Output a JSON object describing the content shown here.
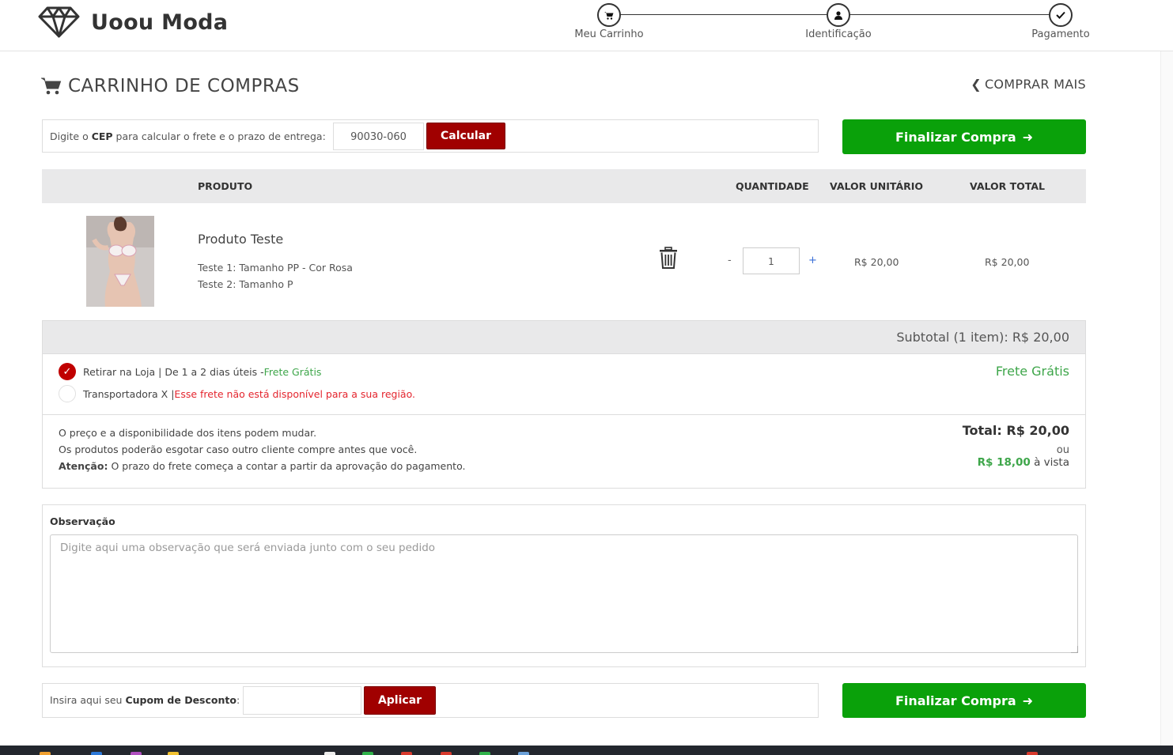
{
  "brand": {
    "name": "Uoou Moda",
    "logo_icon": "diamond-icon"
  },
  "steps": [
    {
      "label": "Meu Carrinho",
      "icon": "cart-icon"
    },
    {
      "label": "Identificação",
      "icon": "user-icon"
    },
    {
      "label": "Pagamento",
      "icon": "check-icon"
    }
  ],
  "page": {
    "title": "CARRINHO DE COMPRAS",
    "shop_more": "COMPRAR MAIS"
  },
  "cep": {
    "label_pre": "Digite o ",
    "label_bold": "CEP",
    "label_post": " para calcular o frete e o prazo de entrega:",
    "value": "90030-060",
    "button": "Calcular"
  },
  "checkout_button": "Finalizar Compra",
  "table": {
    "headers": {
      "product": "PRODUTO",
      "quantity": "QUANTIDADE",
      "unit": "VALOR UNITÁRIO",
      "total": "VALOR TOTAL"
    },
    "items": [
      {
        "name": "Produto Teste",
        "variant1": "Teste 1: Tamanho PP - Cor Rosa",
        "variant2": "Teste 2: Tamanho P",
        "qty": "1",
        "minus": "-",
        "plus": "+",
        "unit_price": "R$ 20,00",
        "total_price": "R$ 20,00"
      }
    ]
  },
  "summary": {
    "subtotal": "Subtotal (1 item): R$ 20,00",
    "shipping": [
      {
        "selected": true,
        "text": "Retirar na Loja | De 1 a 2 dias úteis - ",
        "note": "Frete Grátis"
      },
      {
        "selected": false,
        "text": "Transportadora X | ",
        "note": "Esse frete não está disponível para a sua região."
      }
    ],
    "shipping_price": "Frete Grátis",
    "notes": [
      "O preço e a disponibilidade dos itens podem mudar.",
      "Os produtos poderão esgotar caso outro cliente compre antes que você."
    ],
    "attention_label": "Atenção:",
    "attention_text": " O prazo do frete começa a contar a partir da aprovação do pagamento.",
    "total": "Total: R$ 20,00",
    "or": "ou",
    "cash_price": "R$ 18,00",
    "cash_label": " à vista"
  },
  "observation": {
    "label": "Observação",
    "placeholder": "Digite aqui uma observação que será enviada junto com o seu pedido"
  },
  "coupon": {
    "label_pre": "Insira aqui seu ",
    "label_bold": "Cupom de Desconto",
    "label_post": ":",
    "button": "Aplicar"
  },
  "colors": {
    "green": "#0aa10a",
    "red": "#a00000",
    "price_green": "#3ea64a",
    "alert_red": "#e4252e"
  }
}
